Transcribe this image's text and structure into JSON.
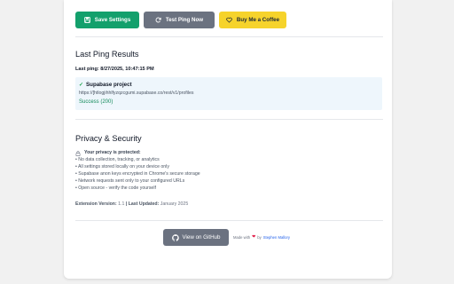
{
  "toolbar": {
    "save_label": "Save Settings",
    "test_label": "Test Ping Now",
    "coffee_label": "Buy Me a Coffee"
  },
  "last_ping": {
    "heading": "Last Ping Results",
    "timestamp_label": "Last ping: 8/27/2025, 10:47:15 PM",
    "result": {
      "project": "Supabase project",
      "url": "https://[htlogjihhlfyzqzcgumi.supabase.co/rest/v1/profiles",
      "status": "Success (200)"
    }
  },
  "privacy": {
    "heading": "Privacy & Security",
    "protected_label": "Your privacy is protected:",
    "items": [
      "• No data collection, tracking, or analytics",
      "• All settings stored locally on your device only",
      "• Supabase anon keys encrypted in Chrome's secure storage",
      "• Network requests sent only to your configured URLs",
      "• Open source - verify the code yourself"
    ],
    "version_label": "Extension Version:",
    "version_value": "1.1",
    "separator": " | ",
    "updated_label": "Last Updated:",
    "updated_value": "January 2025"
  },
  "footer": {
    "github_label": "View on GitHub",
    "made_with": "Made with",
    "by": "by",
    "author": "Stephen Mallory"
  },
  "colors": {
    "save": "#13a06c",
    "test": "#6b7280",
    "coffee": "#f6d32b",
    "success": "#138a5a",
    "result_bg": "#eef6fc"
  },
  "icons": {
    "save": "save-icon",
    "test": "refresh-icon",
    "coffee": "heart-icon",
    "check": "check-icon",
    "lock": "lock-icon",
    "github": "github-icon",
    "heart": "heart-icon"
  }
}
